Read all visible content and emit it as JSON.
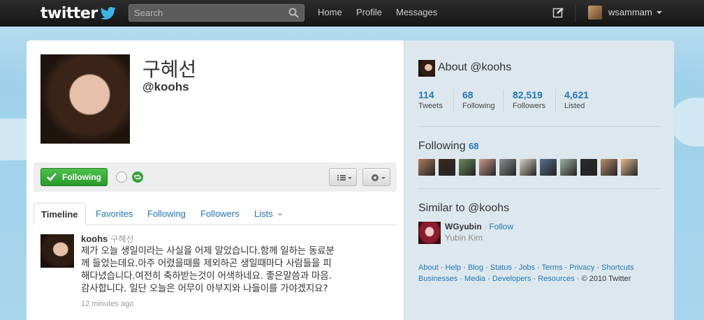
{
  "topbar": {
    "logo_text": "twitter",
    "search_placeholder": "Search",
    "nav": [
      "Home",
      "Profile",
      "Messages"
    ],
    "username": "wsammam"
  },
  "profile": {
    "name": "구혜선",
    "handle": "@koohs"
  },
  "actions": {
    "follow_label": "Following"
  },
  "tabs": [
    "Timeline",
    "Favorites",
    "Following",
    "Followers",
    "Lists"
  ],
  "tweet": {
    "user": "koohs",
    "fullname": "구혜선",
    "lines": [
      "제가 오늘 생일이라는 사실을 어제 알았습니다.함께 일하는 동료분",
      "께 들었는데요.아주 어렸을때를 제외하곤 생일때마다 사람들을 피",
      "해다녔습니다.여전히 축하받는것이 어색하네요. 좋은말씀과 마음.",
      "감사합니다. 일단 오늘은 어무이 아부지와 나들이를 가야겠지요?"
    ],
    "time": "12 minutes ago"
  },
  "sidebar": {
    "about_title": "About @koohs",
    "stats": [
      {
        "num": "114",
        "label": "Tweets"
      },
      {
        "num": "68",
        "label": "Following"
      },
      {
        "num": "82,519",
        "label": "Followers"
      },
      {
        "num": "4,621",
        "label": "Listed"
      }
    ],
    "following_title": "Following",
    "following_count": "68",
    "thumb_colors": [
      "#b07a5a",
      "#3b2a1f",
      "#6b8a5c",
      "#c99a8a",
      "#8d8f92",
      "#d9d2c6",
      "#5a6e8a",
      "#9fb0a0",
      "#2a2a2a",
      "#b88d6a",
      "#e2b98e"
    ],
    "similar_title": "Similar to @koohs",
    "similar_user": "WGyubin",
    "similar_follow": "Follow",
    "similar_sep": " · ",
    "similar_realname": "Yubin Kim",
    "footer_links_1": [
      "About",
      "Help",
      "Blog",
      "Status",
      "Jobs",
      "Terms",
      "Privacy",
      "Shortcuts"
    ],
    "footer_links_2": [
      "Businesses",
      "Media",
      "Developers",
      "Resources"
    ],
    "copyright": "© 2010 Twitter"
  },
  "colors": {
    "link": "#2276bb",
    "follow_green": "#2b9a2b",
    "topbar_bg": "#1c1c1c"
  }
}
